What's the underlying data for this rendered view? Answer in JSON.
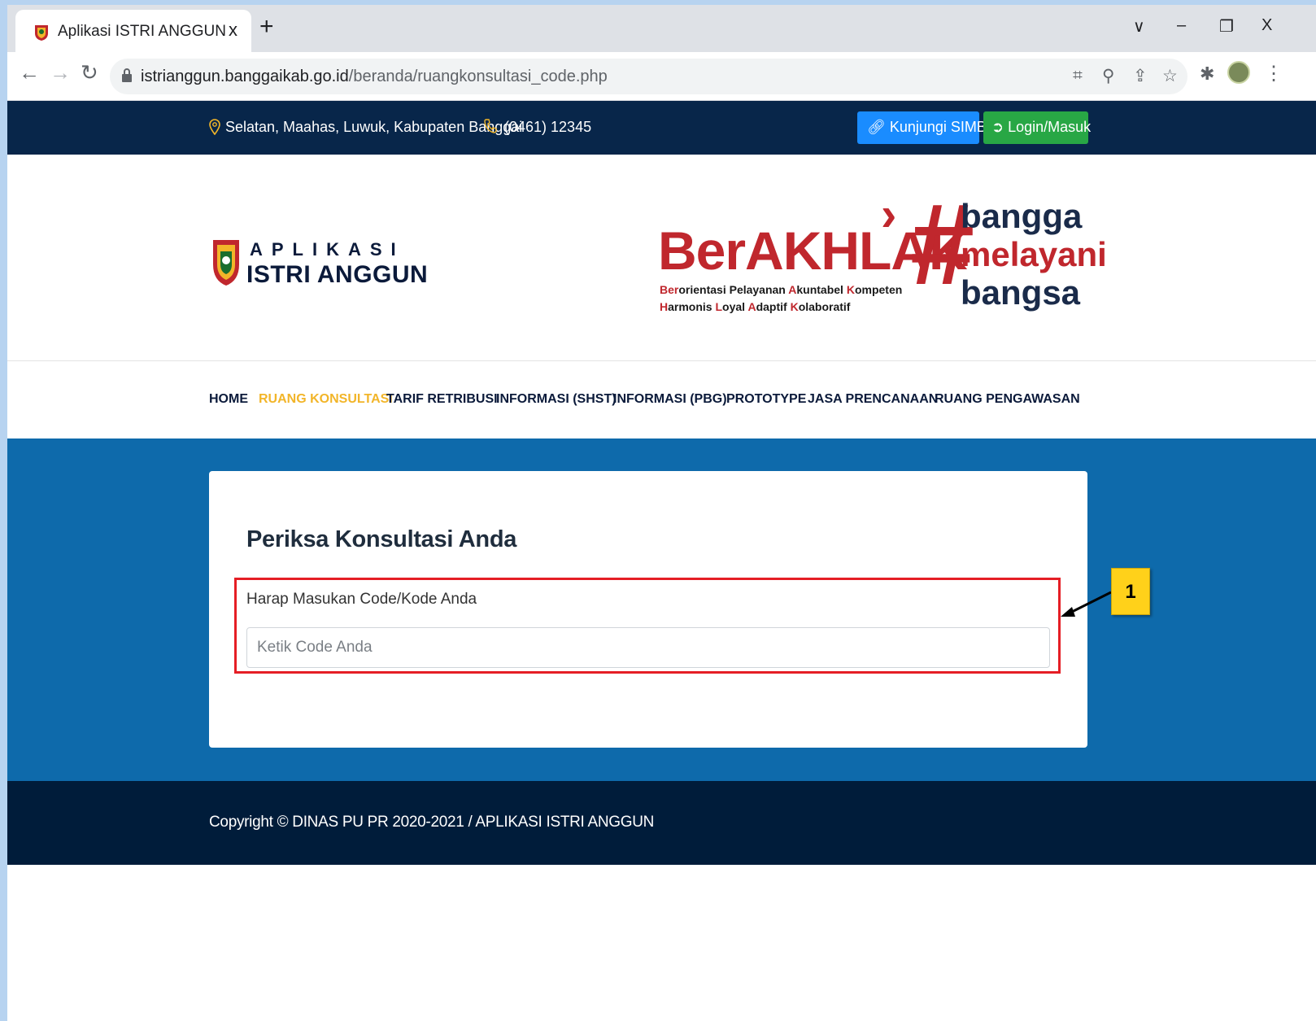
{
  "browser": {
    "tab_title": "Aplikasi ISTRI ANGGUN",
    "tab_close": "x",
    "new_tab": "+",
    "url_domain": "istrianggun.banggaikab.go.id",
    "url_path": "/beranda/ruangkonsultasi_code.php",
    "window_controls": {
      "dropdown": "∨",
      "minimize": "–",
      "restore": "❐",
      "close": "X"
    }
  },
  "topbar": {
    "address": "Selatan, Maahas, Luwuk, Kabupaten Banggai",
    "phone": "(0461) 12345",
    "simbg_button": "Kunjungi SIMBG",
    "login_button": "Login/Masuk"
  },
  "header": {
    "logo_top": "APLIKASI",
    "logo_bottom": "ISTRI ANGGUN",
    "berakhlak": {
      "title": "BerAKHLAK",
      "sub_line1": [
        "Ber",
        "orientasi Pelayanan ",
        "A",
        "kuntabel ",
        "K",
        "ompeten"
      ],
      "sub_line2": [
        "H",
        "armonis ",
        "L",
        "oyal ",
        "A",
        "daptif ",
        "K",
        "olaboratif"
      ]
    },
    "slogan": {
      "hash": "#",
      "line1": "bangga",
      "line2": "melayani",
      "line3": "bangsa"
    }
  },
  "nav": {
    "items": [
      {
        "label": "HOME",
        "active": false
      },
      {
        "label": "RUANG KONSULTASI",
        "active": true
      },
      {
        "label": "TARIF RETRIBUSI",
        "active": false
      },
      {
        "label": "INFORMASI (SHST)",
        "active": false
      },
      {
        "label": "INFORMASI (PBG)",
        "active": false
      },
      {
        "label": "PROTOTYPE",
        "active": false
      },
      {
        "label": "JASA PRENCANAAN",
        "active": false
      },
      {
        "label": "RUANG PENGAWASAN",
        "active": false
      }
    ]
  },
  "form": {
    "title": "Periksa Konsultasi Anda",
    "label": "Harap Masukan Code/Kode Anda",
    "input_value": "",
    "input_placeholder": "Ketik Code Anda"
  },
  "annotation": {
    "label": "1"
  },
  "footer": {
    "copyright": "Copyright © DINAS PU PR 2020-2021 / APLIKASI ISTRI ANGGUN"
  },
  "colors": {
    "topbar_bg": "#08264a",
    "nav_active": "#f2b529",
    "section_bg": "#0e6aab",
    "footer_bg": "#001c3a",
    "simbg_btn": "#1a8cff",
    "login_btn": "#28a745",
    "brand_red": "#c0272d",
    "highlight_red": "#e51e25",
    "callout_yellow": "#ffd11a"
  },
  "icons": [
    "favicon-emblem-icon",
    "back-arrow-icon",
    "forward-arrow-icon",
    "reload-icon",
    "lock-icon",
    "translate-icon",
    "zoom-icon",
    "share-icon",
    "star-icon",
    "puzzle-extension-icon",
    "profile-avatar",
    "kebab-menu-icon",
    "location-pin-icon",
    "phone-icon",
    "link-icon",
    "sign-in-icon"
  ]
}
